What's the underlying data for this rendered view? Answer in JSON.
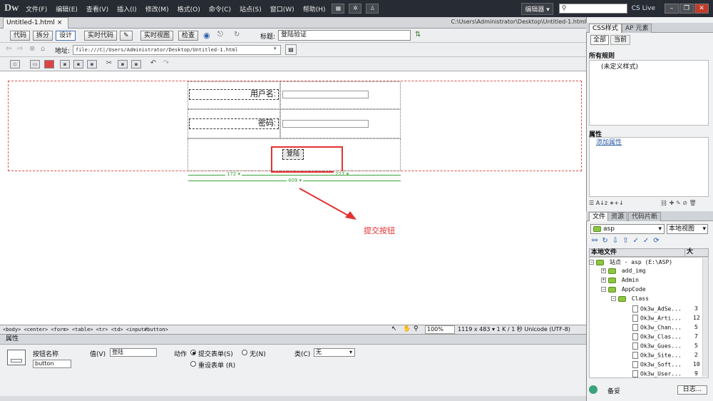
{
  "app": {
    "logo": "Dw",
    "menus": [
      "文件(F)",
      "编辑(E)",
      "查看(V)",
      "插入(I)",
      "修改(M)",
      "格式(O)",
      "命令(C)",
      "站点(S)",
      "窗口(W)",
      "帮助(H)"
    ],
    "workspace": "编辑器 ▾",
    "cslive": "CS Live"
  },
  "doc": {
    "tab": "Untitled-1.html",
    "path": "C:\\Users\\Administrator\\Desktop\\Untitled-1.html"
  },
  "toolbar": {
    "code": "代码",
    "split": "拆分",
    "design": "设计",
    "livecode": "实时代码",
    "liveview": "实时视图",
    "inspect": "检查",
    "title_label": "标题:",
    "title_value": "登陆验证"
  },
  "address": {
    "label": "地址:",
    "value": "file:///C|/Users/Administrator/Desktop/Untitled-1.html"
  },
  "form": {
    "username_label": "用户名:",
    "password_label": "密码:",
    "button_label": "登陆",
    "width_col1": "172 ▾",
    "width_col2": "227 ▾",
    "width_total": "409 ▾"
  },
  "annotation": "提交按钮",
  "status": {
    "tags": "<body> <center> <form> <table> <tr> <td> <input#button>",
    "zoom": "100%",
    "info": "1119 x 483 ▾ 1 K / 1 秒  Unicode (UTF-8)"
  },
  "properties": {
    "header": "属性",
    "name_label": "按钮名称",
    "name_value": "button",
    "value_label": "值(V)",
    "value_value": "登陆",
    "action_label": "动作",
    "action_submit": "提交表单(S)",
    "action_none": "无(N)",
    "action_reset": "重设表单 (R)",
    "class_label": "类(C)",
    "class_value": "无"
  },
  "css_panel": {
    "tab1": "CSS样式",
    "tab2": "AP 元素",
    "btn_all": "全部",
    "btn_current": "当前",
    "rules_header": "所有规则",
    "rules_item": "(未定义样式)",
    "props_header": "属性",
    "add_prop": "添加属性"
  },
  "files_panel": {
    "tab1": "文件",
    "tab2": "资源",
    "tab3": "代码片断",
    "site": "asp",
    "view": "本地视图",
    "col_local": "本地文件",
    "col_size": "大",
    "tree": [
      {
        "name": "站点 - asp (E:\\ASP)",
        "type": "site",
        "size": ""
      },
      {
        "name": "add_img",
        "type": "folder",
        "size": ""
      },
      {
        "name": "Admin",
        "type": "folder",
        "size": ""
      },
      {
        "name": "AppCode",
        "type": "folder",
        "size": ""
      },
      {
        "name": "Class",
        "type": "folder",
        "size": ""
      },
      {
        "name": "Ok3w_AdSe...",
        "type": "file",
        "size": "3"
      },
      {
        "name": "Ok3w_Arti...",
        "type": "file",
        "size": "12"
      },
      {
        "name": "Ok3w_Chan...",
        "type": "file",
        "size": "5"
      },
      {
        "name": "Ok3w_Clas...",
        "type": "file",
        "size": "7"
      },
      {
        "name": "Ok3w_Gues...",
        "type": "file",
        "size": "5"
      },
      {
        "name": "Ok3w_Site...",
        "type": "file",
        "size": "2"
      },
      {
        "name": "Ok3w_Soft...",
        "type": "file",
        "size": "10"
      },
      {
        "name": "Ok3w_User...",
        "type": "file",
        "size": "9"
      }
    ],
    "footer_status": "备妥",
    "footer_log": "日志..."
  }
}
